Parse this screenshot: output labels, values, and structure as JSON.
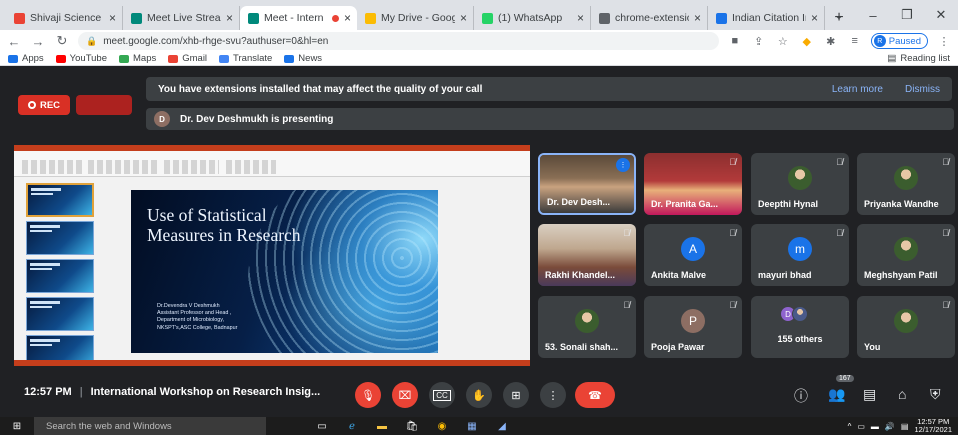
{
  "browser": {
    "tabs": [
      {
        "title": "Shivaji Science C",
        "favicon": "gmail-icon",
        "color": "#ea4335",
        "active": false
      },
      {
        "title": "Meet Live Stream",
        "favicon": "meet-icon",
        "color": "#00897b",
        "active": false
      },
      {
        "title": "Meet - Intern",
        "favicon": "meet-icon",
        "color": "#00897b",
        "active": true
      },
      {
        "title": "My Drive - Goog",
        "favicon": "drive-icon",
        "color": "#fbbc04",
        "active": false
      },
      {
        "title": "(1) WhatsApp",
        "favicon": "whatsapp-icon",
        "color": "#25d366",
        "active": false
      },
      {
        "title": "chrome-extensio",
        "favicon": "puzzle-icon",
        "color": "#5f6368",
        "active": false
      },
      {
        "title": "Indian Citation In",
        "favicon": "citation-icon",
        "color": "#1a73e8",
        "active": false
      }
    ],
    "url": "meet.google.com/xhb-rhge-svu?authuser=0&hl=en",
    "profile_status": "Paused",
    "profile_initial": "R"
  },
  "bookmarks": {
    "items": [
      {
        "label": "Apps",
        "color": "#1a73e8"
      },
      {
        "label": "YouTube",
        "color": "#ff0000"
      },
      {
        "label": "Maps",
        "color": "#34a853"
      },
      {
        "label": "Gmail",
        "color": "#ea4335"
      },
      {
        "label": "Translate",
        "color": "#4285f4"
      },
      {
        "label": "News",
        "color": "#1a73e8"
      }
    ],
    "reading_list": "Reading list"
  },
  "meet": {
    "rec_label": "REC",
    "extension_warning": "You have extensions installed that may affect the quality of your call",
    "learn_more": "Learn more",
    "dismiss": "Dismiss",
    "presenter_initial": "D",
    "presenting_text": "Dr. Dev Deshmukh is presenting",
    "slide": {
      "title_line1": "Use of Statistical",
      "title_line2": "Measures in Research",
      "author_line1": "Dr.Devendra V Deshmukh",
      "author_line2": "Assistant Professor and Head ,",
      "author_line3": "Department of Microbiology,",
      "author_line4": "NKSPT's,ASC College, Badnapur"
    },
    "participants": [
      {
        "name": "Dr. Dev Desh...",
        "type": "photo",
        "active": true
      },
      {
        "name": "Dr. Pranita Ga...",
        "type": "photo",
        "active": false
      },
      {
        "name": "Deepthi Hynal",
        "type": "avatar-photo",
        "active": false
      },
      {
        "name": "Priyanka Wandhe",
        "type": "avatar-photo",
        "active": false
      },
      {
        "name": "Rakhi Khandel...",
        "type": "photo",
        "active": false
      },
      {
        "name": "Ankita Malve",
        "type": "letter",
        "letter": "A",
        "color": "#1a73e8",
        "active": false
      },
      {
        "name": "mayuri bhad",
        "type": "letter",
        "letter": "m",
        "color": "#1a73e8",
        "active": false
      },
      {
        "name": "Meghshyam Patil",
        "type": "avatar-photo",
        "active": false
      },
      {
        "name": "53. Sonali shah...",
        "type": "avatar-photo",
        "active": false
      },
      {
        "name": "Pooja Pawar",
        "type": "letter",
        "letter": "P",
        "color": "#8d6e63",
        "active": false
      },
      {
        "name": "155 others",
        "type": "others",
        "active": false
      },
      {
        "name": "You",
        "type": "avatar-photo",
        "active": false
      }
    ],
    "others_initial": "D",
    "time": "12:57 PM",
    "meeting_title": "International Workshop on Research Insig...",
    "participant_count": "167"
  },
  "taskbar": {
    "search_placeholder": "Search the web and Windows",
    "time": "12:57 PM",
    "date": "12/17/2021"
  }
}
